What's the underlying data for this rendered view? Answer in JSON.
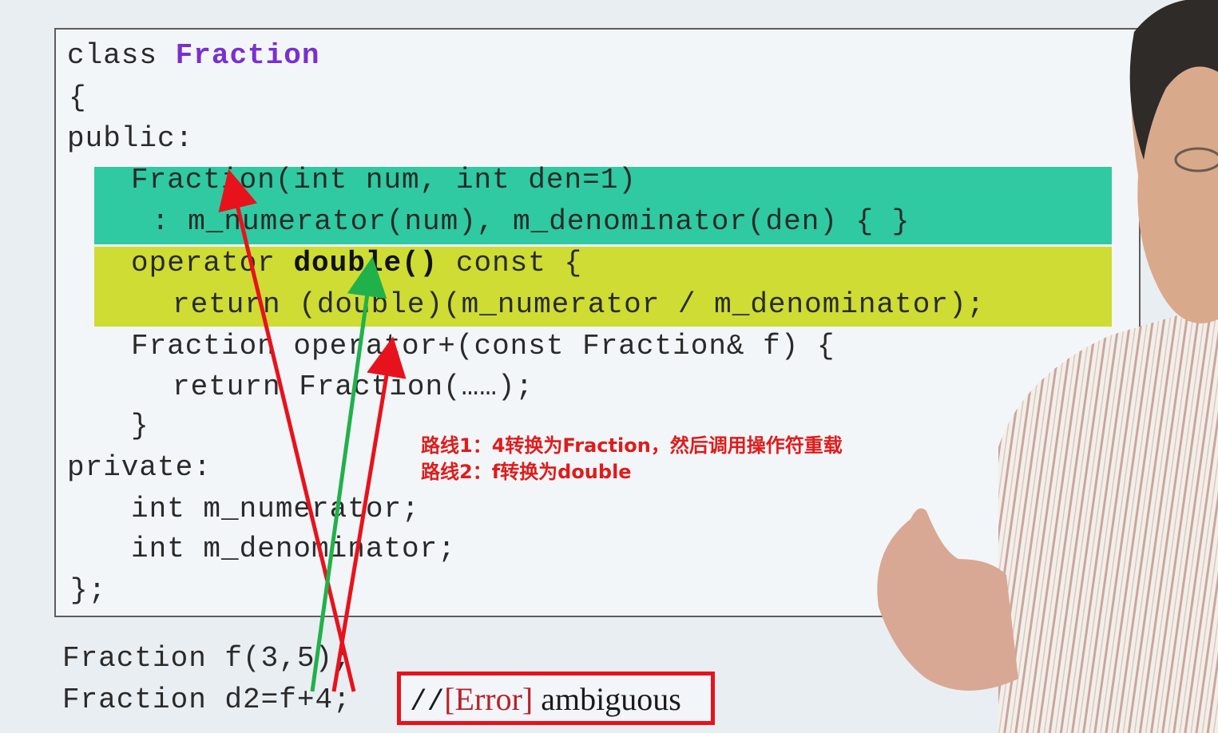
{
  "code": {
    "class_kw": "class",
    "class_name": "Fraction",
    "open_brace": "{",
    "public_kw": "public:",
    "ctor_line1": "Fraction(int num, int den=1)",
    "ctor_line2": ": m_numerator(num), m_denominator(den) { }",
    "op_double_prefix": "operator ",
    "op_double_name": "double()",
    "op_double_suffix": " const {",
    "op_double_body": "return (double)(m_numerator / m_denominator);",
    "op_plus_line": "Fraction operator+(const Fraction& f) {",
    "op_plus_body": "return Fraction(……);",
    "close_inner": "}",
    "private_kw": "private:",
    "member1": "int m_numerator;",
    "member2": "int m_denominator;",
    "close_class": "};"
  },
  "usage": {
    "line1": "Fraction f(3,5);",
    "line2": "Fraction d2=f+4;"
  },
  "error_comment": {
    "slashes": "//",
    "error_tag": "[Error]",
    "message": " ambiguous"
  },
  "annotations": {
    "route1": "路线1：4转换为Fraction，然后调用操作符重载",
    "route2": "路线2：f转换为double"
  },
  "colors": {
    "constructor_highlight": "#2fcaa2",
    "conversion_highlight": "#cedc34",
    "arrow_red": "#e8121c",
    "arrow_green": "#21b14a",
    "class_name": "#7a2fd0",
    "note_text": "#e01b1b"
  }
}
